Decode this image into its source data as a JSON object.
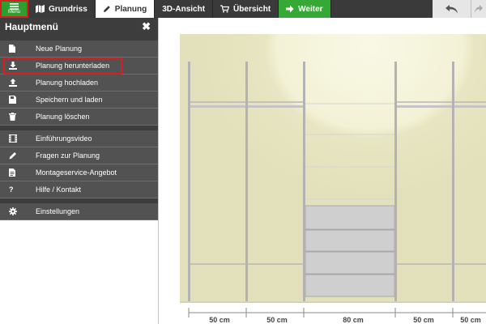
{
  "toolbar": {
    "menu_label": "Menü",
    "tabs": {
      "grundriss": "Grundriss",
      "planung": "Planung",
      "ansicht_prefix": "3D",
      "ansicht": "3D-Ansicht",
      "uebersicht": "Übersicht",
      "weiter": "Weiter"
    }
  },
  "menu": {
    "title": "Hauptmenü",
    "items": [
      {
        "label": "Neue Planung",
        "icon": "file-icon"
      },
      {
        "label": "Planung herunterladen",
        "icon": "download-icon",
        "highlighted": true
      },
      {
        "label": "Planung hochladen",
        "icon": "upload-icon"
      },
      {
        "label": "Speichern und laden",
        "icon": "save-icon"
      },
      {
        "label": "Planung löschen",
        "icon": "trash-icon"
      },
      {
        "label": "Einführungsvideo",
        "icon": "film-icon"
      },
      {
        "label": "Fragen zur Planung",
        "icon": "pencil-icon"
      },
      {
        "label": "Montageservice-Angebot",
        "icon": "document-icon"
      },
      {
        "label": "Hilfe / Kontakt",
        "icon": "question-icon"
      },
      {
        "label": "Einstellungen",
        "icon": "gear-icon"
      }
    ]
  },
  "dimensions": [
    "50 cm",
    "50 cm",
    "80 cm",
    "50 cm",
    "50 cm"
  ],
  "colors": {
    "menu_green": "#2f9e2f",
    "highlight_red": "#d42020",
    "wall": "#e9e7c4"
  }
}
